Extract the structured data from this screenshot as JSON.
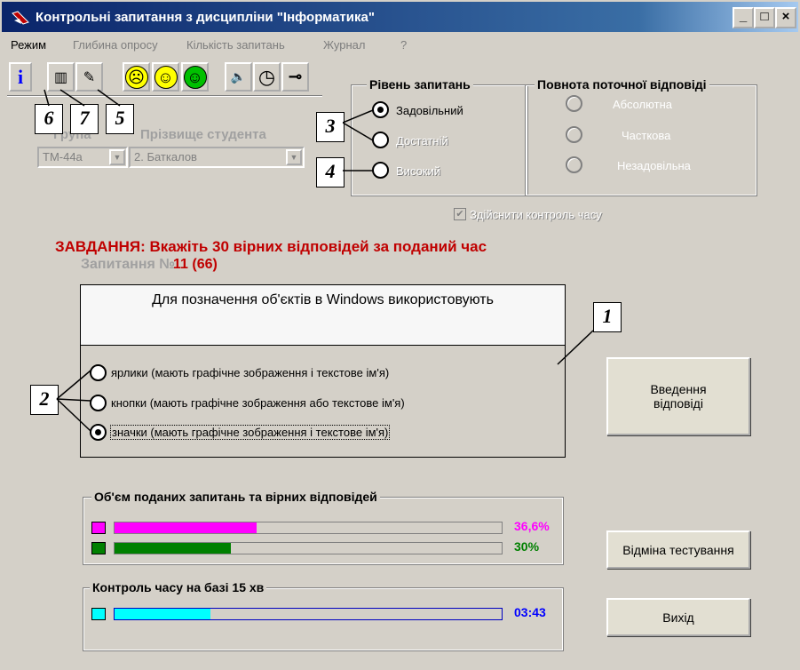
{
  "window": {
    "title": "Контрольні запитання з дисципліни \"Інформатика\"",
    "app_icon": "pen-icon",
    "minimize": "_",
    "maximize": "□",
    "close": "×"
  },
  "menu": [
    "Режим",
    "Глибина опросу",
    "Кількість запитань",
    "Журнал",
    "?"
  ],
  "toolbar": {
    "info": "i",
    "book": "▥",
    "notes": "✎",
    "face_sad": "☹",
    "face_neutral": "☺",
    "face_happy": "☺",
    "sound": "🔈",
    "clock": "◷",
    "key": "⊸"
  },
  "callouts": {
    "c1": "1",
    "c2": "2",
    "c3": "3",
    "c4": "4",
    "c5": "5",
    "c6": "6",
    "c7": "7"
  },
  "student": {
    "group_label": "Група",
    "name_label": "Прізвище студента",
    "group_value": "ТМ-44а",
    "name_value": "2. Баткалов",
    "arrow": "▼"
  },
  "level": {
    "title": "Рівень запитань",
    "options": [
      "Задовільний",
      "Достатній",
      "Високий"
    ],
    "selected": "Задовільний"
  },
  "completeness": {
    "title": "Повнота поточної відповіді",
    "options": [
      "Абсолютна",
      "Часткова",
      "Незадовільна"
    ]
  },
  "time_control": {
    "check": "✔",
    "label": "Здійснити контроль часу"
  },
  "task": {
    "heading": "ЗАВДАННЯ: Вкажіть 30 вірних відповідей за поданий час",
    "question_label": "Запитання №",
    "question_number": "11 (66)"
  },
  "question": {
    "text": "Для позначення об'єктів в Windows використовують",
    "answers": [
      "ярлики (мають графічне зображення і текстове ім'я)",
      "кнопки (мають графічне зображення або текстове ім'я)",
      "значки (мають графічне зображення і текстове ім'я)"
    ],
    "selected_index": 2
  },
  "buttons": {
    "submit": "Введення відповіді",
    "cancel": "Відміна тестування",
    "exit": "Вихід"
  },
  "progress": {
    "title": "Об'єм поданих запитань та вірних відповідей",
    "asked_percent_label": "36,6%",
    "asked_fraction": 0.366,
    "correct_percent_label": "30%",
    "correct_fraction": 0.3,
    "asked_color": "#ff00ff",
    "correct_color": "#008000"
  },
  "timer": {
    "title": "Контроль часу на базі 15 хв",
    "value": "03:43",
    "fraction": 0.248,
    "color": "#00ffff"
  }
}
